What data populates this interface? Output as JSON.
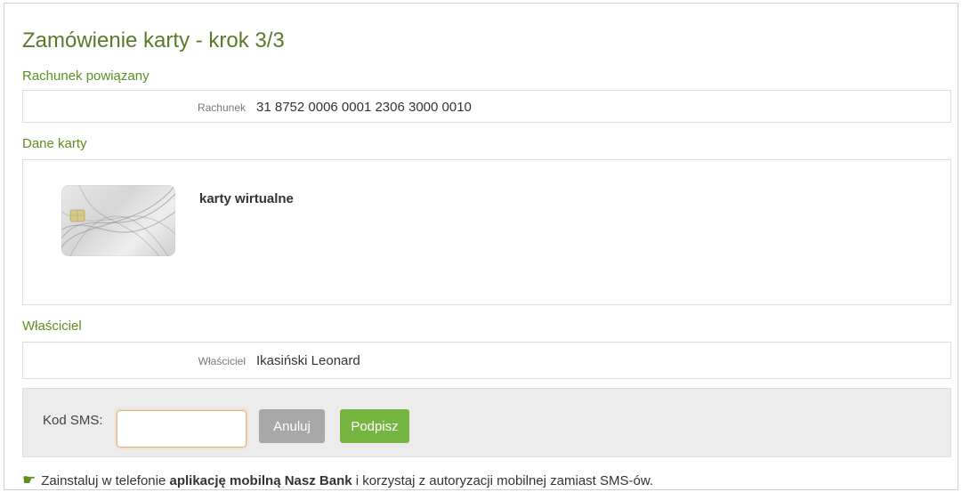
{
  "page": {
    "title": "Zamówienie karty - krok 3/3"
  },
  "account_section": {
    "label": "Rachunek powiązany",
    "field_label": "Rachunek",
    "field_value": "31 8752 0006 0001 2306 3000 0010"
  },
  "card_section": {
    "label": "Dane karty",
    "card_name": "karty wirtualne",
    "card_image_icon": "card-image"
  },
  "owner_section": {
    "label": "Właściciel",
    "field_label": "Właściciel",
    "field_value": "Ikasiński Leonard"
  },
  "sms": {
    "label": "Kod SMS:",
    "input_value": "",
    "cancel_label": "Anuluj",
    "sign_label": "Podpisz"
  },
  "promo": {
    "icon": "hand-pointer-icon",
    "text_before": "Zainstaluj w telefonie ",
    "bold": "aplikację mobilną Nasz Bank",
    "text_after": " i korzystaj z autoryzacji mobilnej zamiast SMS-ów."
  },
  "colors": {
    "accent_green": "#5b8f1e",
    "sign_button": "#77b541",
    "cancel_button": "#a8a8a8",
    "sms_bar_bg": "#ececec"
  }
}
